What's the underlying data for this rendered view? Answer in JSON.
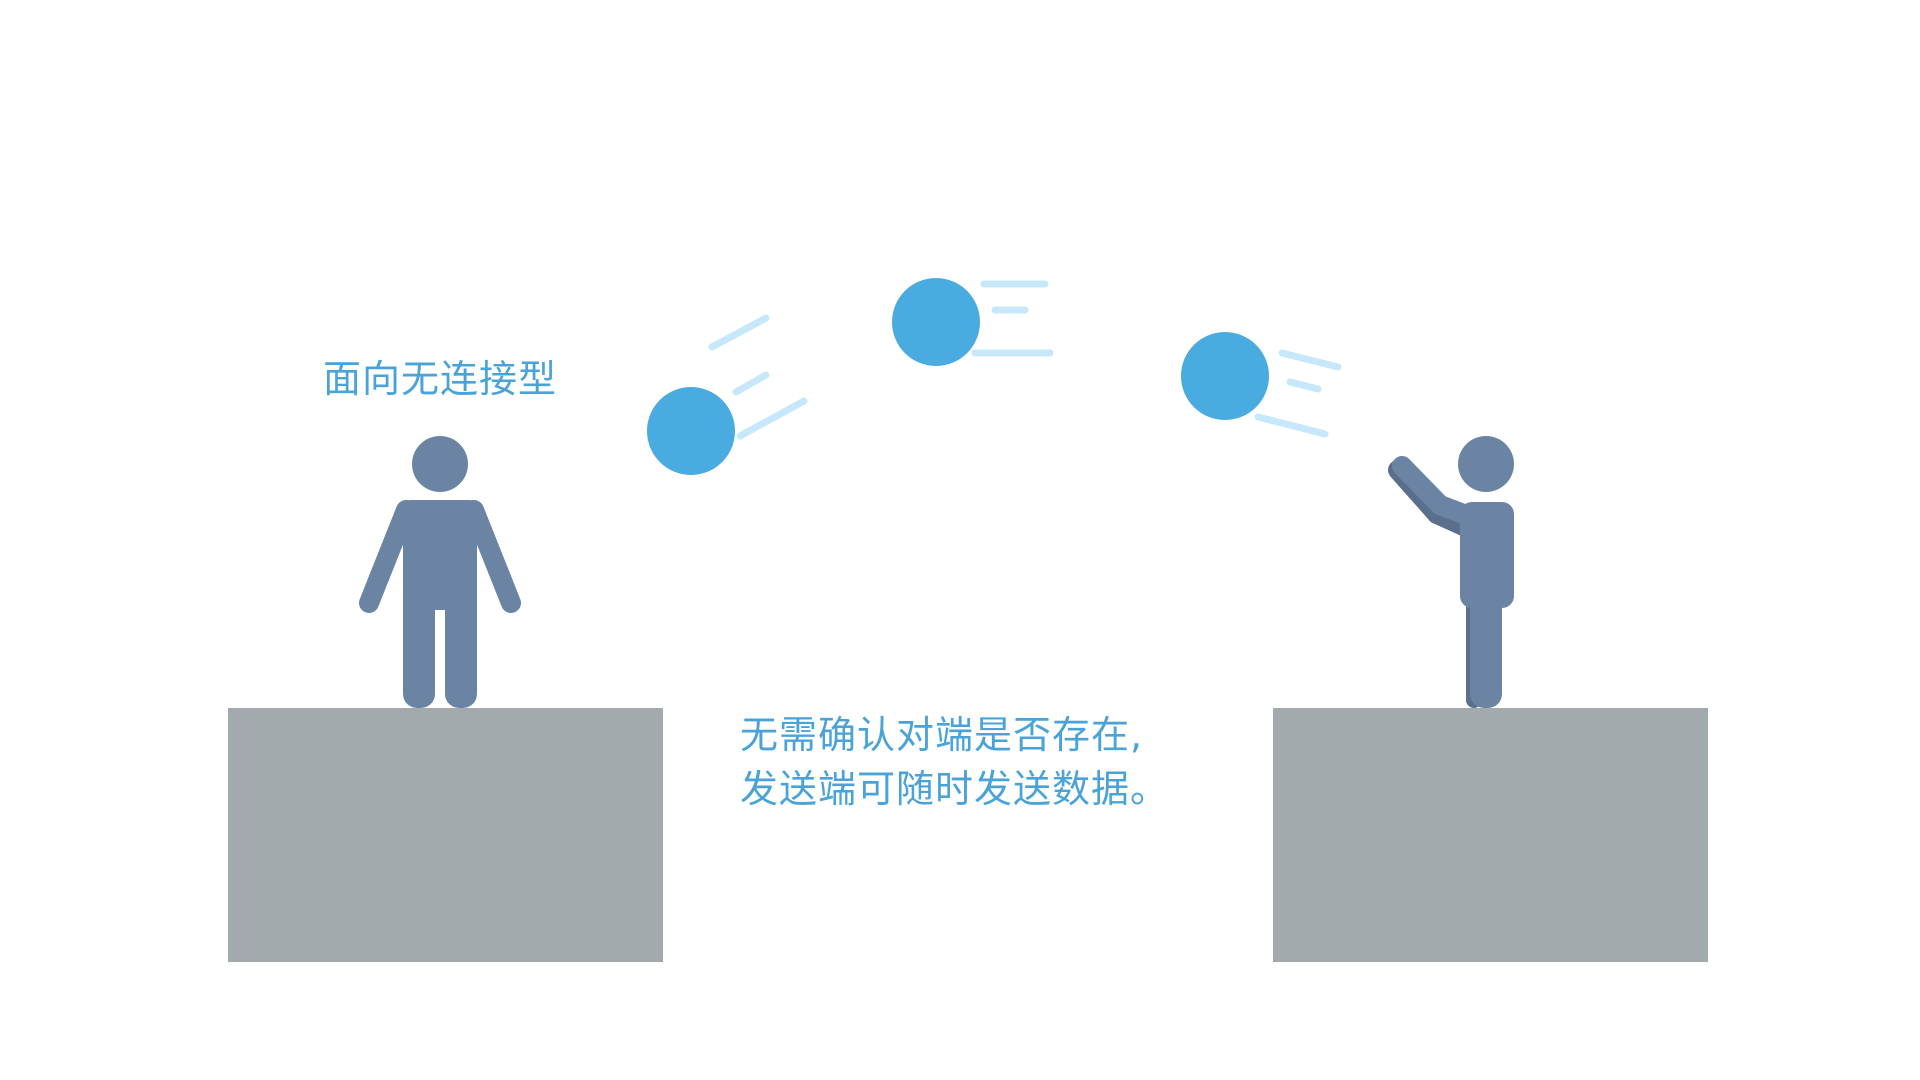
{
  "labels": {
    "title": "面向无连接型",
    "caption_line1": "无需确认对端是否存在,",
    "caption_line2": "发送端可随时发送数据。"
  },
  "colors": {
    "person": "#6b84a3",
    "person_shadow": "#5a6f8c",
    "platform": "#a3aaae",
    "ball": "#4aabe0",
    "motion_line": "#c6e8fa",
    "text": "#4aa3d8"
  },
  "icons": {
    "receiver": "standing-person-icon",
    "sender": "throwing-person-icon",
    "packet": "flying-ball-icon"
  }
}
